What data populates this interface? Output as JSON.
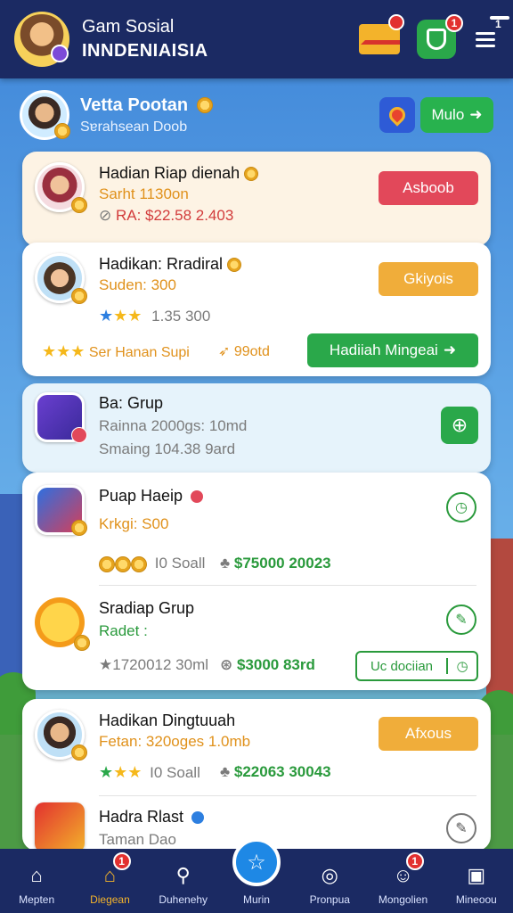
{
  "header": {
    "title_line1": "Gam Sosial",
    "title_line2": "INNDENIAISIA",
    "mail_badge": "",
    "shield_badge": "1",
    "menu_badge": "1"
  },
  "profile": {
    "name": "Vetta Pootan",
    "subtitle": "Sɐrahsean Doob",
    "button_label": "Mulo"
  },
  "card1": {
    "title": "Hadian Riap dienah",
    "line1": "Sarht 1130on",
    "line2": "RA: $22.58 2.403",
    "button": "Asboob"
  },
  "card2": {
    "title": "Hadikan: Rradiral",
    "line1": "Suden: 300",
    "rating": "1.35 300",
    "footer_left": "Ser Hanan Supi",
    "footer_mid": "99otd",
    "button": "Gkiyois",
    "green_button": "Hadiiah Mingeai"
  },
  "card3": {
    "title": "Ba: Grup",
    "line1": "Rainna 2000gs: 10md",
    "line2": "Smaing 104.38 9ard"
  },
  "card4": {
    "row1_title": "Puap Haeip",
    "row1_line": "Krkgi: S00",
    "row1_left": "I0 Soall",
    "row1_price": "$75000 20023",
    "row2_title": "Sradiap Grup",
    "row2_line": "Radet :",
    "row2_left": "1720012 30ml",
    "row2_price": "$3000 83rd",
    "row2_button": "Uc dociian"
  },
  "card5": {
    "row1_title": "Hadikan Dingtuuah",
    "row1_line": "Fetan: 320oges 1.0mb",
    "row1_left": "I0 Soall",
    "row1_price": "$22063 30043",
    "row1_button": "Afxous",
    "row2_title": "Hadra Rlast",
    "row2_line": "Taman Dao"
  },
  "nav": {
    "items": [
      {
        "label": "Mepten",
        "badge": ""
      },
      {
        "label": "Diegean",
        "badge": "1"
      },
      {
        "label": "Duhenehy",
        "badge": ""
      },
      {
        "label": "Murin",
        "badge": ""
      },
      {
        "label": "Pronpua",
        "badge": ""
      },
      {
        "label": "Mongolien",
        "badge": "1"
      },
      {
        "label": "Mineoou",
        "badge": ""
      }
    ]
  },
  "colors": {
    "header_bg": "#1b2a63",
    "accent_red": "#e2485a",
    "accent_orange": "#f0ad3a",
    "accent_green": "#2aa84a"
  }
}
